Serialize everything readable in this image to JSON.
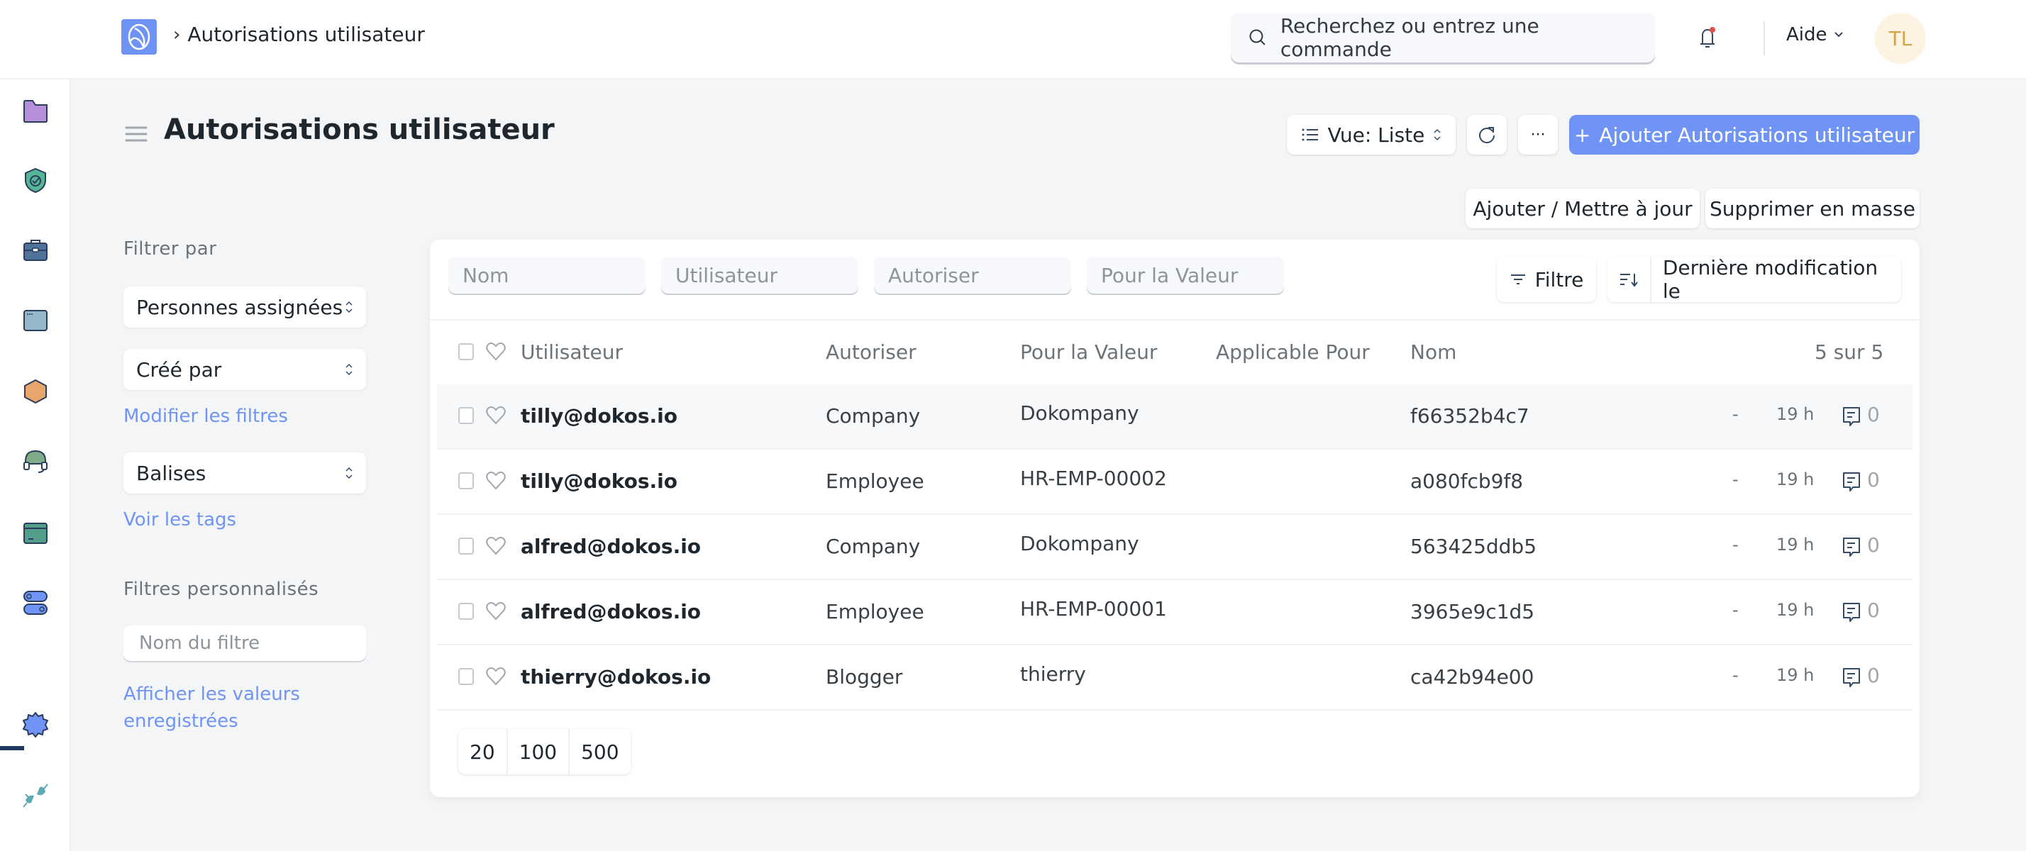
{
  "navbar": {
    "breadcrumb": "Autorisations utilisateur",
    "search_placeholder": "Recherchez ou entrez une commande",
    "help_label": "Aide",
    "avatar_initials": "TL",
    "notification_dot_color": "#e24c4c"
  },
  "rail": {
    "icons": [
      "folder-icon",
      "shield-check-icon",
      "briefcase-icon",
      "browser-window-icon",
      "hexagon-icon",
      "headset-icon",
      "terminal-card-icon",
      "toggles-icon",
      "gear-icon",
      "plug-icon"
    ]
  },
  "page": {
    "title": "Autorisations utilisateur",
    "view_label": "Vue: Liste",
    "more_label": "···",
    "add_button": "Ajouter Autorisations utilisateur",
    "add_update_button": "Ajouter / Mettre à jour",
    "bulk_delete_button": "Supprimer en masse",
    "primary_color": "#6f94f5"
  },
  "sidebar": {
    "filter_by_label": "Filtrer par",
    "assigned_to": "Personnes assignées",
    "created_by": "Créé par",
    "edit_filters_link": "Modifier les filtres",
    "tags": "Balises",
    "show_tags_link": "Voir les tags",
    "custom_filters_label": "Filtres personnalisés",
    "filter_name_placeholder": "Nom du filtre",
    "show_saved_link_line1": "Afficher les valeurs",
    "show_saved_link_line2": "enregistrées"
  },
  "list": {
    "standard_filters": [
      "Nom",
      "Utilisateur",
      "Autoriser",
      "Pour la Valeur"
    ],
    "filter_button": "Filtre",
    "sort_label": "Dernière modification le",
    "columns": [
      "Utilisateur",
      "Autoriser",
      "Pour la Valeur",
      "Applicable Pour",
      "Nom"
    ],
    "count_label": "5 sur 5",
    "rows": [
      {
        "user": "tilly@dokos.io",
        "allow": "Company",
        "for_value": "Dokompany",
        "applicable_for": "",
        "name": "f66352b4c7",
        "dash": "-",
        "modified": "19 h",
        "comments": "0"
      },
      {
        "user": "tilly@dokos.io",
        "allow": "Employee",
        "for_value": "HR-EMP-00002",
        "applicable_for": "",
        "name": "a080fcb9f8",
        "dash": "-",
        "modified": "19 h",
        "comments": "0"
      },
      {
        "user": "alfred@dokos.io",
        "allow": "Company",
        "for_value": "Dokompany",
        "applicable_for": "",
        "name": "563425ddb5",
        "dash": "-",
        "modified": "19 h",
        "comments": "0"
      },
      {
        "user": "alfred@dokos.io",
        "allow": "Employee",
        "for_value": "HR-EMP-00001",
        "applicable_for": "",
        "name": "3965e9c1d5",
        "dash": "-",
        "modified": "19 h",
        "comments": "0"
      },
      {
        "user": "thierry@dokos.io",
        "allow": "Blogger",
        "for_value": "thierry",
        "applicable_for": "",
        "name": "ca42b94e00",
        "dash": "-",
        "modified": "19 h",
        "comments": "0"
      }
    ],
    "page_sizes": [
      "20",
      "100",
      "500"
    ]
  }
}
